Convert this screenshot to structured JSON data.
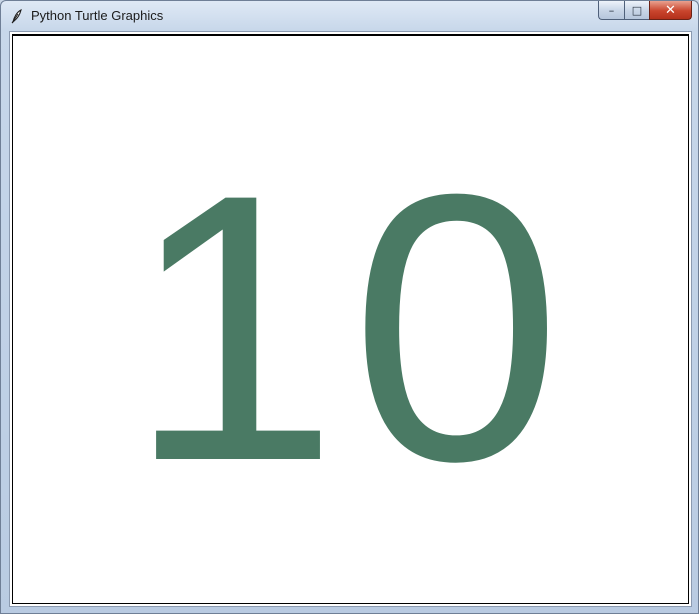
{
  "window": {
    "title": "Python Turtle Graphics",
    "icon": "feather-icon",
    "controls": {
      "minimize_glyph": "–",
      "maximize_glyph": "□",
      "close_glyph": "✕"
    }
  },
  "canvas": {
    "text": "10",
    "text_color": "#4a7a64",
    "background": "#ffffff"
  }
}
